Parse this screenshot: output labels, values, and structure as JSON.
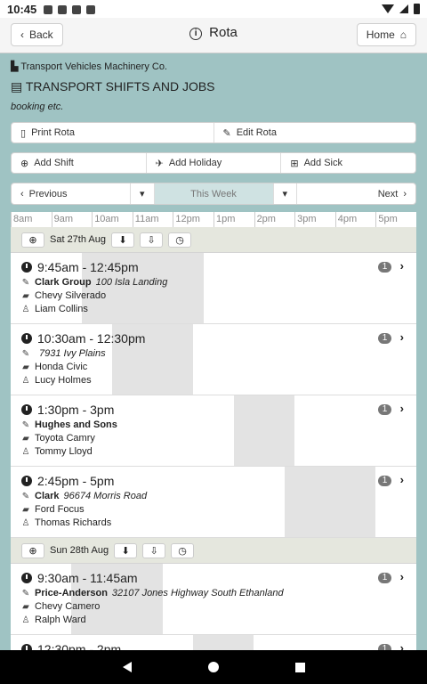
{
  "status": {
    "time": "10:45"
  },
  "header": {
    "back_label": "Back",
    "title": "Rota",
    "home_label": "Home"
  },
  "company": "Transport Vehicles Machinery Co.",
  "page_title": "TRANSPORT SHIFTS AND JOBS",
  "subtitle": "booking etc.",
  "actions1": {
    "print": "Print Rota",
    "edit": "Edit Rota"
  },
  "actions2": {
    "add_shift": "Add Shift",
    "add_holiday": "Add Holiday",
    "add_sick": "Add Sick"
  },
  "weeknav": {
    "previous": "Previous",
    "current": "This Week",
    "next": "Next"
  },
  "timeline": [
    "8am",
    "9am",
    "10am",
    "11am",
    "12pm",
    "1pm",
    "2pm",
    "3pm",
    "4pm",
    "5pm"
  ],
  "days": [
    {
      "label": "Sat 27th Aug",
      "shifts": [
        {
          "time": "9:45am - 12:45pm",
          "client": "Clark Group",
          "address": "100 Isla Landing",
          "vehicle": "Chevy Silverado",
          "driver": "Liam Collins",
          "count": "1"
        },
        {
          "time": "10:30am - 12:30pm",
          "client": "",
          "address": "7931 Ivy Plains",
          "vehicle": "Honda Civic",
          "driver": "Lucy Holmes",
          "count": "1"
        },
        {
          "time": "1:30pm - 3pm",
          "client": "Hughes and Sons",
          "address": "",
          "vehicle": "Toyota Camry",
          "driver": "Tommy Lloyd",
          "count": "1"
        },
        {
          "time": "2:45pm - 5pm",
          "client": "Clark",
          "address": "96674 Morris Road",
          "vehicle": "Ford Focus",
          "driver": "Thomas Richards",
          "count": "1"
        }
      ]
    },
    {
      "label": "Sun 28th Aug",
      "shifts": [
        {
          "time": "9:30am - 11:45am",
          "client": "Price-Anderson",
          "address": "32107 Jones Highway South Ethanland",
          "vehicle": "Chevy Camero",
          "driver": "Ralph Ward",
          "count": "1"
        },
        {
          "time": "12:30pm - 2pm",
          "client": "",
          "address": "",
          "vehicle": "",
          "driver": "",
          "count": "1"
        }
      ]
    }
  ]
}
